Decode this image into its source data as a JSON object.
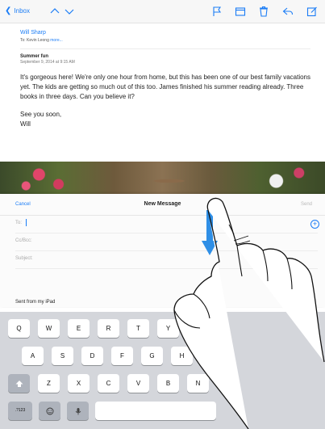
{
  "toolbar": {
    "back_label": "Inbox",
    "icons": [
      "chevron-up-icon",
      "chevron-down-icon",
      "flag-icon",
      "folder-icon",
      "trash-icon",
      "reply-icon",
      "compose-icon"
    ]
  },
  "message": {
    "sender": "Will Sharp",
    "to_prefix": "To: Kevin Leong",
    "to_more": "more...",
    "subject": "Summer fun",
    "date": "September 9, 2014 at 9:15 AM",
    "body": "It's gorgeous here! We're only one hour from home, but this has been one of our best family vacations yet. The kids are getting so much out of this too. James finished his summer reading already. Three books in three days. Can you believe it?",
    "signoff_line1": "See you soon,",
    "signoff_line2": "Will"
  },
  "compose": {
    "cancel_label": "Cancel",
    "title": "New Message",
    "send_label": "Send",
    "to_label": "To:",
    "cc_label": "Cc/Bcc:",
    "subject_label": "Subject:",
    "signature": "Sent from my iPad"
  },
  "keyboard": {
    "row1": [
      "Q",
      "W",
      "E",
      "R",
      "T",
      "Y"
    ],
    "row2": [
      "A",
      "S",
      "D",
      "F",
      "G",
      "H"
    ],
    "row3": [
      "Z",
      "X",
      "C",
      "V",
      "B",
      "N"
    ],
    "numbers_label": ".?123",
    "icons": [
      "shift-icon",
      "emoji-icon",
      "microphone-icon"
    ]
  },
  "colors": {
    "accent": "#1a7cf6",
    "keyboard_bg": "#d4d6db",
    "arrow": "#2f8fe6"
  }
}
